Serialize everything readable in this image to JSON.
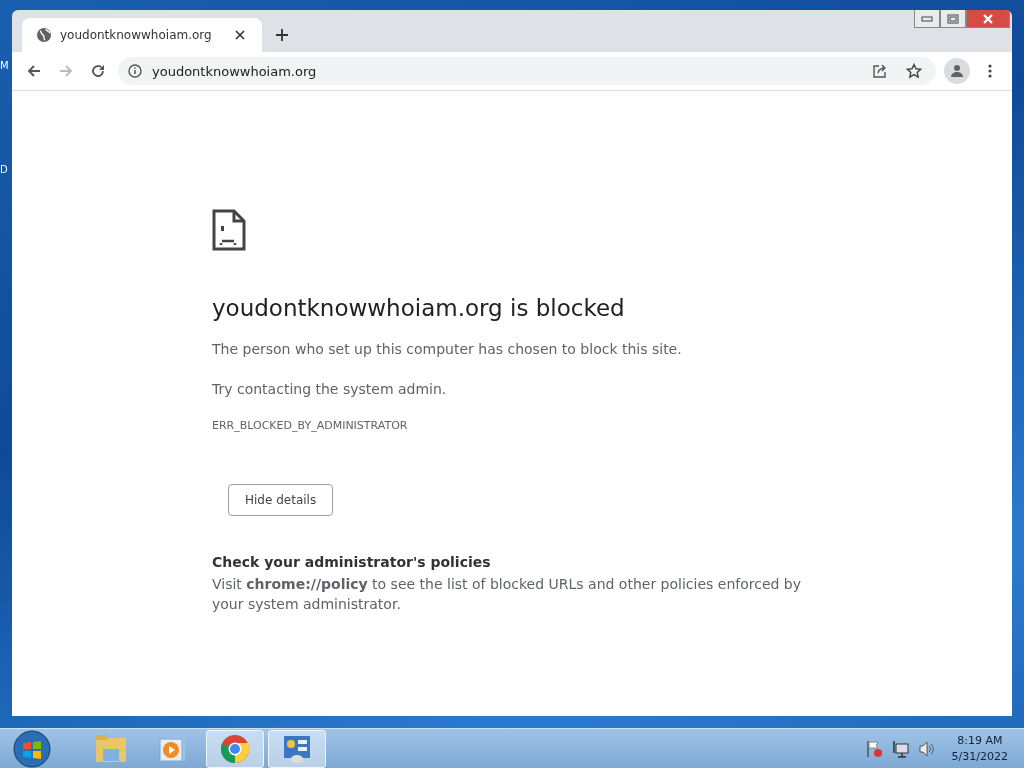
{
  "desktop": {
    "labels": [
      "M",
      "D"
    ]
  },
  "browser": {
    "tabs": [
      {
        "title": "youdontknowwhoiam.org",
        "selected": true
      }
    ],
    "nav_buttons": [
      {
        "kind": "back",
        "disabled": false
      },
      {
        "kind": "forward",
        "disabled": true
      },
      {
        "kind": "reload",
        "disabled": false
      }
    ],
    "address": "youdontknowwhoiam.org"
  },
  "page": {
    "heading": "youdontknowwhoiam.org is blocked",
    "message": "The person who set up this computer has chosen to block this site.",
    "hint": "Try contacting the system admin.",
    "error_code": "ERR_BLOCKED_BY_ADMINISTRATOR",
    "details_button": "Hide details",
    "details_title": "Check your administrator's policies",
    "details_text": "Visit **chrome://policy** to see the list of blocked URLs and other policies enforced by your system administrator."
  },
  "taskbar": {
    "apps": [
      {
        "kind": "explorer",
        "running": false
      },
      {
        "kind": "media",
        "running": false
      },
      {
        "kind": "chrome",
        "running": true
      },
      {
        "kind": "control",
        "running": true
      }
    ],
    "clock": {
      "time": "8:19 AM",
      "date": "5/31/2022"
    }
  }
}
